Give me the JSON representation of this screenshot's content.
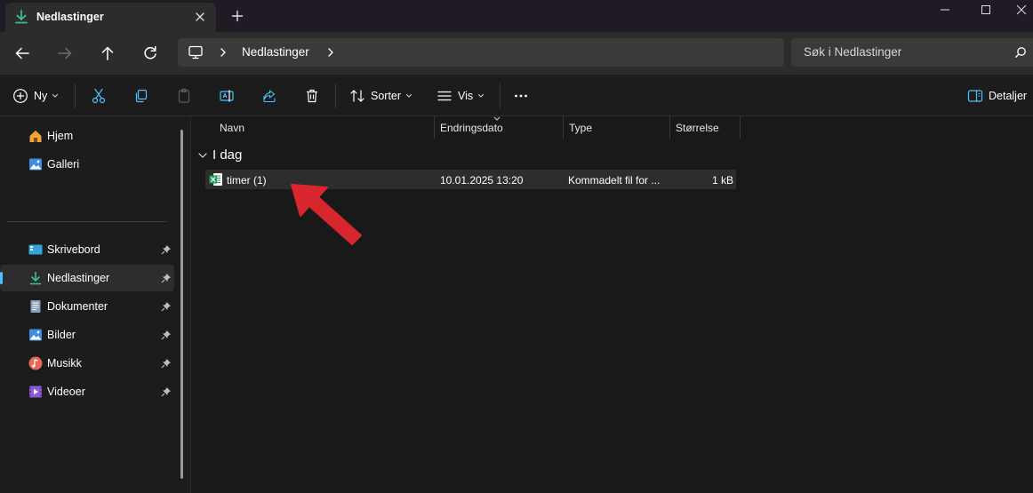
{
  "window": {
    "tab_title": "Nedlastinger",
    "tab_icon": "download-icon",
    "new_tab_icon": "plus-icon"
  },
  "nav": {
    "breadcrumb": [
      "Nedlastinger"
    ],
    "search_placeholder": "Søk i Nedlastinger"
  },
  "toolbar": {
    "new_label": "Ny",
    "sort_label": "Sorter",
    "view_label": "Vis",
    "details_label": "Detaljer"
  },
  "sidebar": {
    "top_items": [
      {
        "label": "Hjem",
        "icon": "home-icon"
      },
      {
        "label": "Galleri",
        "icon": "gallery-icon"
      }
    ],
    "pinned_items": [
      {
        "label": "Skrivebord",
        "icon": "desktop-icon"
      },
      {
        "label": "Nedlastinger",
        "icon": "download-icon",
        "selected": true
      },
      {
        "label": "Dokumenter",
        "icon": "documents-icon"
      },
      {
        "label": "Bilder",
        "icon": "pictures-icon"
      },
      {
        "label": "Musikk",
        "icon": "music-icon"
      },
      {
        "label": "Videoer",
        "icon": "videos-icon"
      }
    ]
  },
  "columns": {
    "name": "Navn",
    "date": "Endringsdato",
    "type": "Type",
    "size": "Størrelse"
  },
  "groups": [
    {
      "label": "I dag",
      "files": [
        {
          "name": "timer (1)",
          "date": "10.01.2025 13:20",
          "type": "Kommadelt fil for ...",
          "size": "1 kB",
          "icon": "excel-csv-icon"
        }
      ]
    }
  ],
  "colors": {
    "accent": "#4cc2ff",
    "download_green": "#3fbf8f",
    "excel_green": "#1f9d55",
    "annotation_arrow": "#d7262e"
  }
}
